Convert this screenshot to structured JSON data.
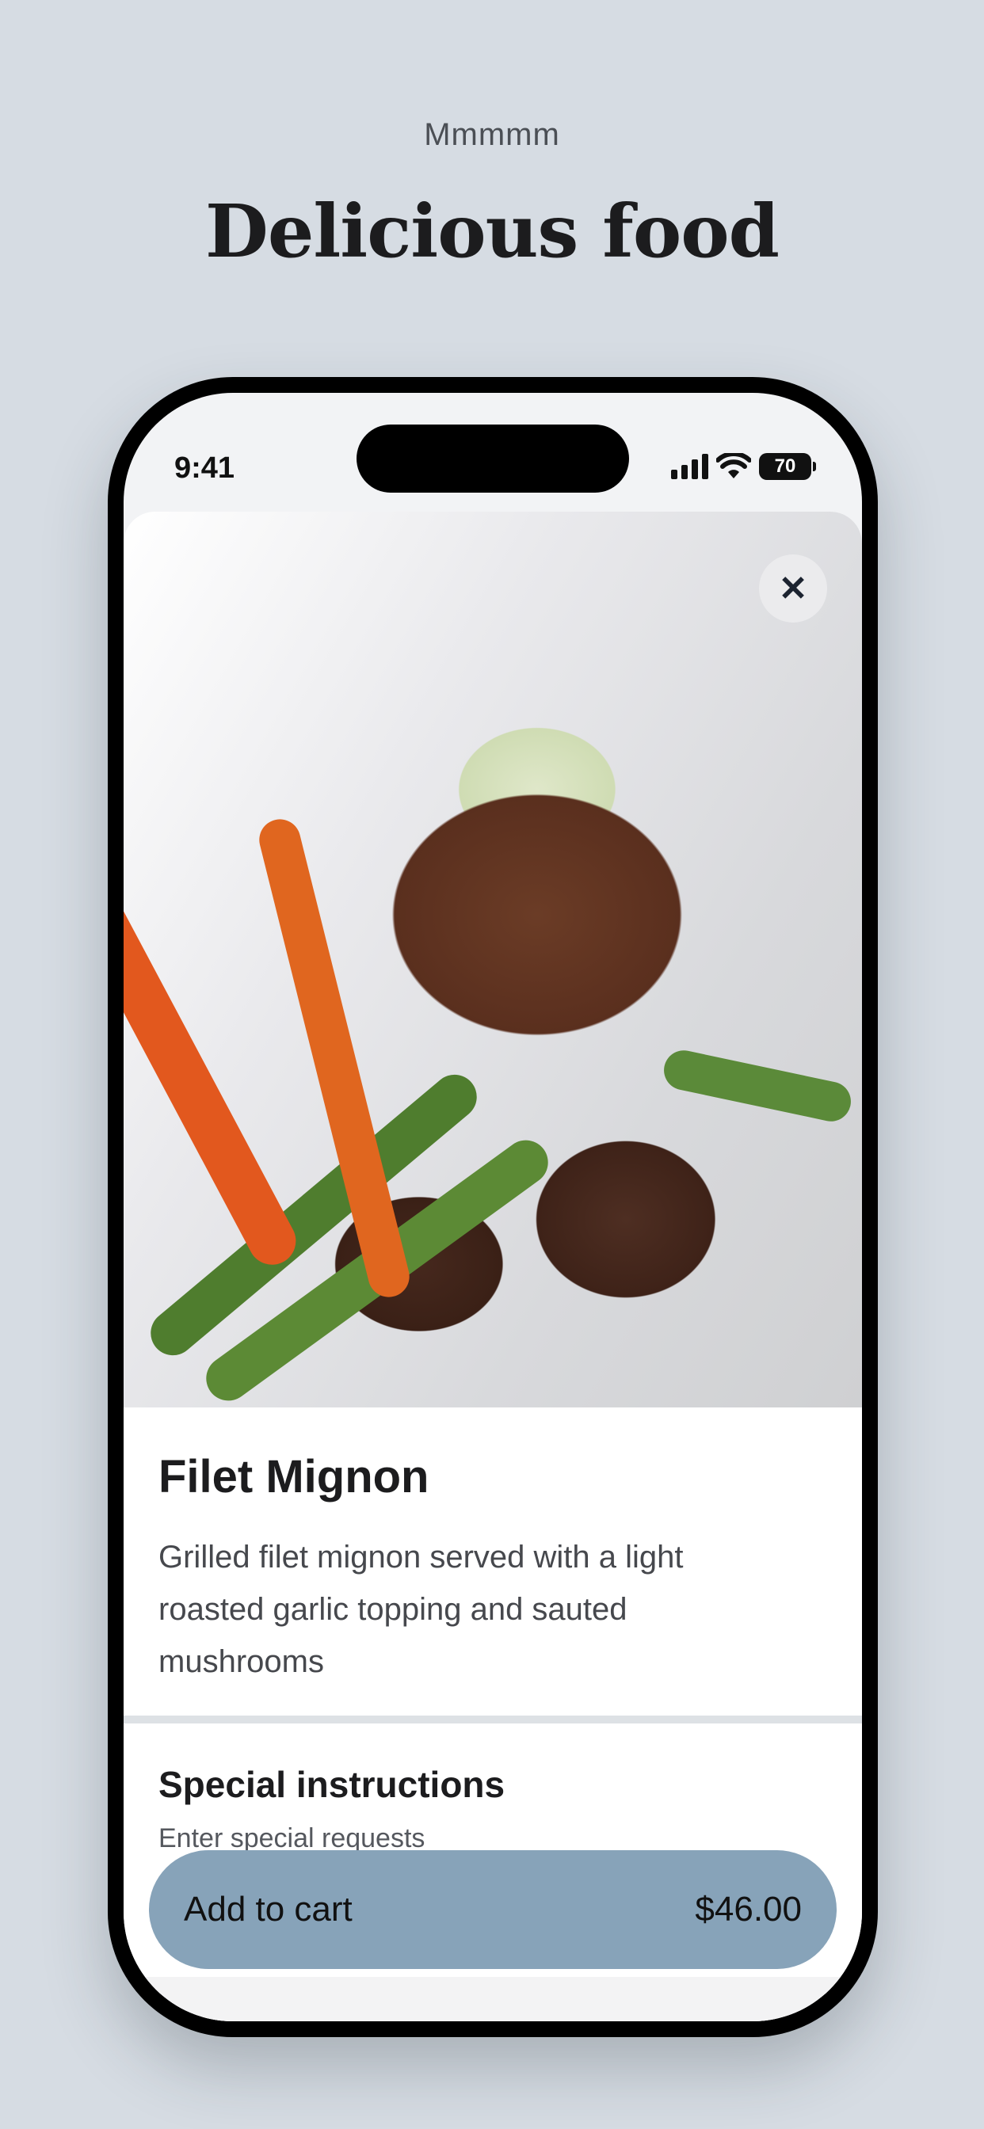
{
  "header": {
    "eyebrow": "Mmmmm",
    "title": "Delicious food"
  },
  "status_bar": {
    "time": "9:41",
    "battery": "70"
  },
  "item": {
    "image_icon": "filet-mignon-photo",
    "close_icon": "close-icon",
    "name": "Filet Mignon",
    "description": "Grilled filet mignon served with a light roasted garlic topping and sauted mushrooms"
  },
  "special_instructions": {
    "title": "Special instructions",
    "placeholder": "Enter special requests"
  },
  "cart": {
    "label": "Add to cart",
    "price": "$46.00",
    "color": "#87a3b9"
  },
  "colors": {
    "background": "#d6dce3",
    "text": "#1c1c1e"
  }
}
